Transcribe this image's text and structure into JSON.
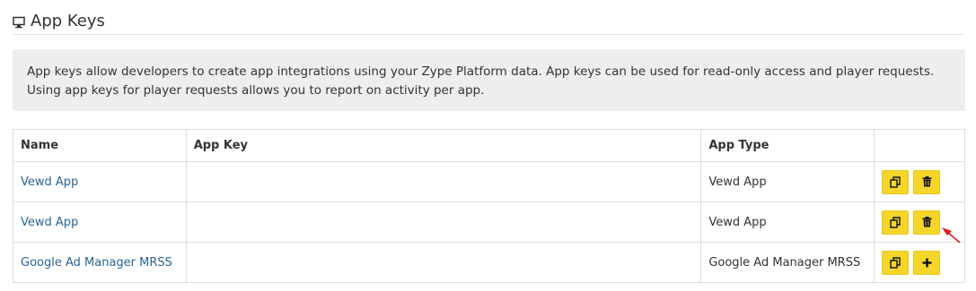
{
  "page": {
    "title": "App Keys",
    "title_icon": "monitor-icon",
    "description": "App keys allow developers to create app integrations using your Zype Platform data. App keys can be used for read-only access and player requests. Using app keys for player requests allows you to report on activity per app."
  },
  "table": {
    "headers": {
      "name": "Name",
      "app_key": "App Key",
      "app_type": "App Type",
      "actions": ""
    },
    "rows": [
      {
        "name": "Vewd App",
        "app_key": "",
        "app_type": "Vewd App",
        "action_icons": [
          "copy-icon",
          "trash-icon"
        ]
      },
      {
        "name": "Vewd App",
        "app_key": "",
        "app_type": "Vewd App",
        "action_icons": [
          "copy-icon",
          "trash-icon"
        ]
      },
      {
        "name": "Google Ad Manager MRSS",
        "app_key": "",
        "app_type": "Google Ad Manager MRSS",
        "action_icons": [
          "copy-icon",
          "plus-icon"
        ]
      }
    ]
  },
  "colors": {
    "button_yellow": "#f6d52b",
    "link_blue": "#2a6496",
    "info_bg": "#eeeeee",
    "pointer_arrow": "#e8141e"
  }
}
